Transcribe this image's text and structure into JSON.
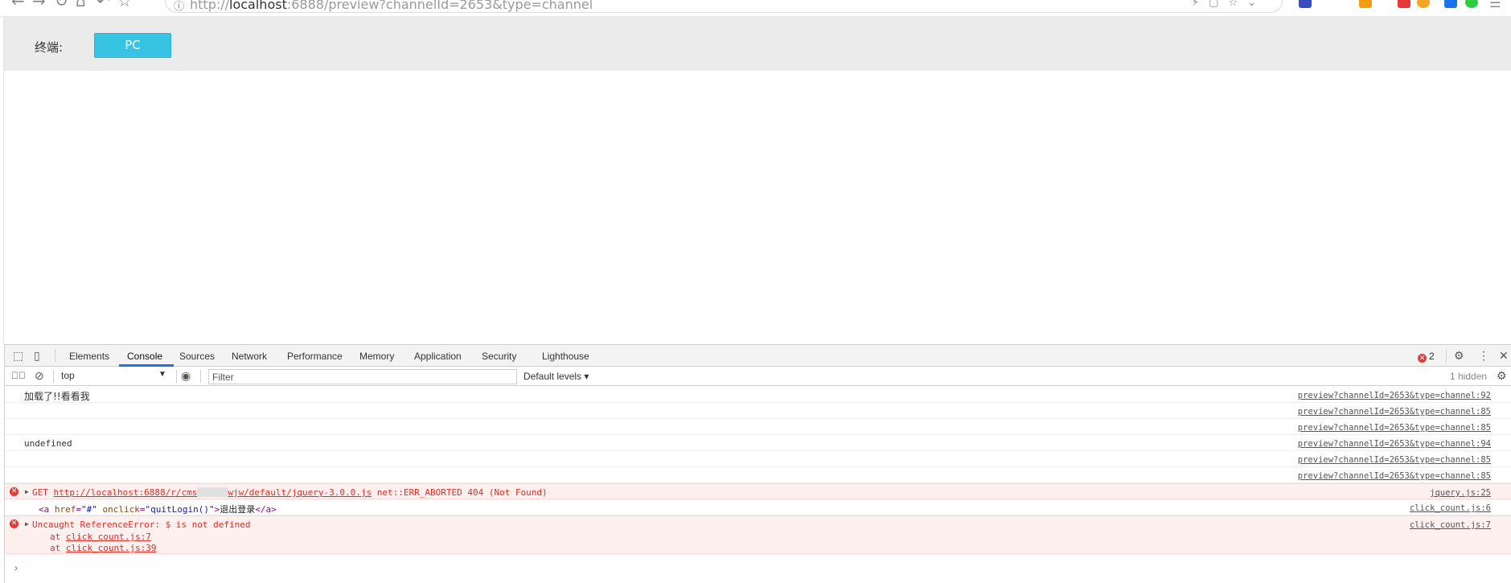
{
  "browser": {
    "url_prefix": "http://",
    "url_host": "localhost",
    "url_rest": ":6888/preview?channelId=2653&type=channel"
  },
  "page": {
    "terminal_label": "终端:",
    "pc_button": "PC",
    "accent": "#37c3e2"
  },
  "devtools": {
    "tabs": [
      "Elements",
      "Console",
      "Sources",
      "Network",
      "Performance",
      "Memory",
      "Application",
      "Security",
      "Lighthouse"
    ],
    "active_tab": "Console",
    "error_count": "2",
    "context": "top",
    "filter_placeholder": "Filter",
    "levels": "Default levels ▾",
    "hidden": "1 hidden",
    "messages": [
      {
        "text": "加载了!!看看我",
        "source": "preview?channelId=2653&type=channel:92"
      },
      {
        "text": "",
        "source": "preview?channelId=2653&type=channel:85"
      },
      {
        "text": "",
        "source": "preview?channelId=2653&type=channel:85"
      },
      {
        "text": "undefined",
        "source": "preview?channelId=2653&type=channel:94"
      },
      {
        "text": "",
        "source": "preview?channelId=2653&type=channel:85"
      },
      {
        "text": "",
        "source": "preview?channelId=2653&type=channel:85"
      }
    ],
    "error1": {
      "method": "GET",
      "url_a": "http://localhost:6888/r/cms",
      "url_b": "wjw/default/jquery-3.0.0.js",
      "status": " net::ERR_ABORTED 404 (Not Found)",
      "source": "jquery.js:25"
    },
    "code_line": {
      "tag_open": "<a ",
      "href_attr": "href",
      "href_val": "\"#\"",
      "onclick_attr": "onclick",
      "onclick_val": "\"quitLogin()\"",
      "tag_close_start": ">",
      "label": "退出登录",
      "tag_end": "</a>",
      "source": "click_count.js:6"
    },
    "error2": {
      "message": "Uncaught ReferenceError: $ is not defined",
      "stack": [
        {
          "prefix": "at ",
          "link": "click_count.js:7"
        },
        {
          "prefix": "at ",
          "link": "click_count.js:39"
        }
      ],
      "source": "click_count.js:7"
    }
  }
}
